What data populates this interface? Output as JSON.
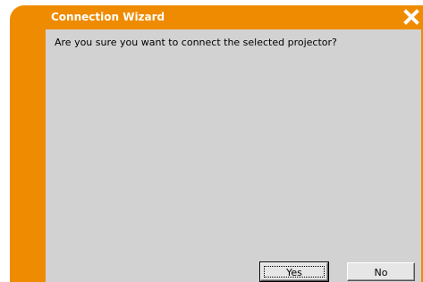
{
  "window": {
    "title": "Connection Wizard",
    "accent_color": "#ef8b00",
    "content_bg": "#d2d2d2",
    "close_icon": "close-icon"
  },
  "dialog": {
    "message": "Are you sure you want to connect the selected projector?",
    "yes_label": "Yes",
    "no_label": "No"
  }
}
